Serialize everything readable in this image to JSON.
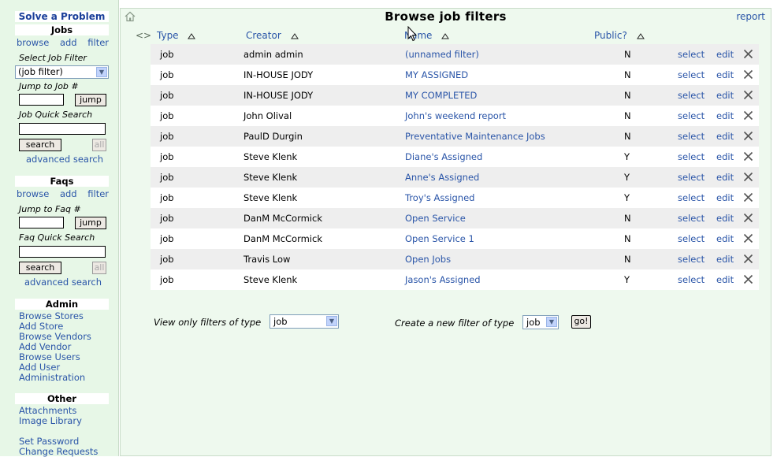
{
  "sidebar": {
    "solve_title": "Solve a Problem",
    "jobs": {
      "title": "Jobs",
      "links": [
        "browse",
        "add",
        "filter"
      ],
      "select_label": "Select Job Filter",
      "select_value": "(job filter)",
      "jump_label": "Jump to Job #",
      "jump_button": "jump",
      "quick_search_label": "Job Quick Search",
      "search_button": "search",
      "all_button": "all",
      "advanced": "advanced search"
    },
    "faqs": {
      "title": "Faqs",
      "links": [
        "browse",
        "add",
        "filter"
      ],
      "jump_label": "Jump to Faq #",
      "jump_button": "jump",
      "quick_search_label": "Faq Quick Search",
      "search_button": "search",
      "all_button": "all",
      "advanced": "advanced search"
    },
    "admin": {
      "title": "Admin",
      "links": [
        "Browse Stores",
        "Add Store",
        "Browse Vendors",
        "Add Vendor",
        "Browse Users",
        "Add User",
        "Administration"
      ]
    },
    "other": {
      "title": "Other",
      "links": [
        "Attachments",
        "Image Library"
      ],
      "links2": [
        "Set Password",
        "Change Requests"
      ]
    }
  },
  "header": {
    "title": "Browse job filters",
    "report_link": "report"
  },
  "table": {
    "expand_icon": "<>",
    "columns": [
      "Type",
      "Creator",
      "Name",
      "Public?"
    ],
    "actions": [
      "select",
      "edit"
    ],
    "rows": [
      {
        "type": "job",
        "creator": "admin admin",
        "name": "(unnamed filter)",
        "public": "N"
      },
      {
        "type": "job",
        "creator": "IN-HOUSE JODY",
        "name": "MY ASSIGNED",
        "public": "N"
      },
      {
        "type": "job",
        "creator": "IN-HOUSE JODY",
        "name": "MY COMPLETED",
        "public": "N"
      },
      {
        "type": "job",
        "creator": "John Olival",
        "name": "John's weekend report",
        "public": "N"
      },
      {
        "type": "job",
        "creator": "PaulD Durgin",
        "name": "Preventative Maintenance Jobs",
        "public": "N"
      },
      {
        "type": "job",
        "creator": "Steve Klenk",
        "name": "Diane's Assigned",
        "public": "Y"
      },
      {
        "type": "job",
        "creator": "Steve Klenk",
        "name": "Anne's Assigned",
        "public": "Y"
      },
      {
        "type": "job",
        "creator": "Steve Klenk",
        "name": "Troy's Assigned",
        "public": "Y"
      },
      {
        "type": "job",
        "creator": "DanM McCormick",
        "name": "Open Service",
        "public": "N"
      },
      {
        "type": "job",
        "creator": "DanM McCormick",
        "name": "Open Service 1",
        "public": "N"
      },
      {
        "type": "job",
        "creator": "Travis Low",
        "name": "Open Jobs",
        "public": "N"
      },
      {
        "type": "job",
        "creator": "Steve Klenk",
        "name": "Jason's Assigned",
        "public": "Y"
      }
    ]
  },
  "footer": {
    "view_label": "View only filters of type",
    "view_value": "job",
    "create_label": "Create a new filter of type",
    "create_value": "job",
    "go_button": "go!"
  },
  "colors": {
    "sidebar_bg": "#e7f7e7",
    "main_bg": "#eef9ee",
    "link": "#2a55a8",
    "row_shade": "#eeeeee"
  }
}
